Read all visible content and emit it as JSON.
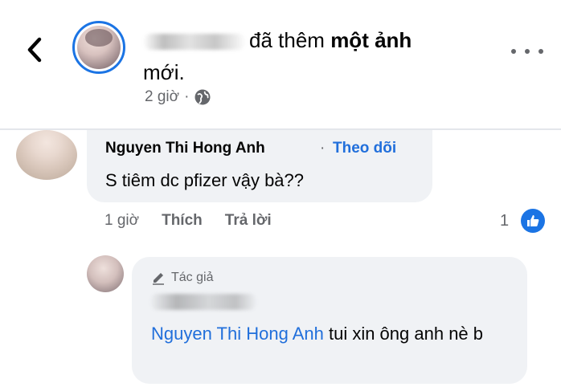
{
  "header": {
    "action_prefix": "đã thêm",
    "action_bold": "một ảnh",
    "action_suffix": "mới.",
    "time": "2 giờ",
    "separator": "·",
    "privacy_icon": "globe-icon",
    "back_icon": "chevron-left-icon",
    "more_icon": "more-horizontal-icon"
  },
  "comments": [
    {
      "author": "Nguyen Thi Hong Anh",
      "separator": "·",
      "follow_label": "Theo dõi",
      "text": "S tiêm dc pfizer vậy bà??",
      "time": "1 giờ",
      "like_label": "Thích",
      "reply_label": "Trả lời",
      "reaction_count": "1",
      "reaction_icon": "like-thumb-icon"
    }
  ],
  "reply": {
    "author_badge": "Tác giả",
    "badge_icon": "pencil-icon",
    "mention": "Nguyen Thi Hong Anh",
    "text": " tui xin ông anh nè b"
  },
  "colors": {
    "accent": "#1b74e4",
    "link": "#216fdb",
    "muted": "#65676b",
    "bubble": "#f0f2f5"
  }
}
